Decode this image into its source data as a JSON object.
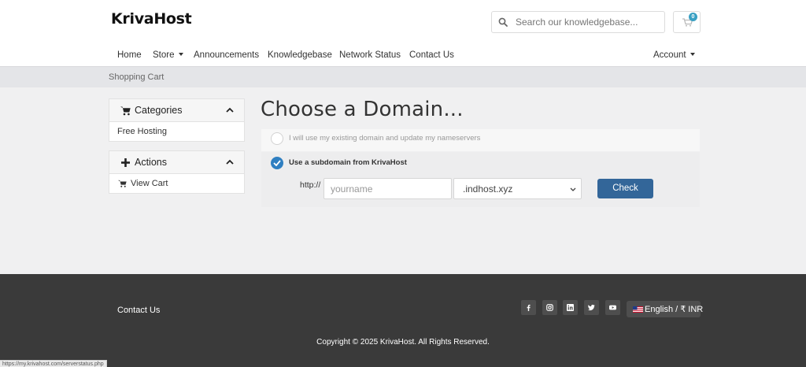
{
  "header": {
    "logo": "KrivaHost",
    "search_placeholder": "Search our knowledgebase...",
    "cart_count": "0"
  },
  "nav": {
    "home": "Home",
    "store": "Store",
    "announcements": "Announcements",
    "knowledgebase": "Knowledgebase",
    "network_status": "Network Status",
    "contact_us": "Contact Us",
    "account": "Account"
  },
  "breadcrumb": "Shopping Cart",
  "sidebar": {
    "categories": {
      "title": "Categories",
      "items": [
        "Free Hosting"
      ]
    },
    "actions": {
      "title": "Actions",
      "items": [
        "View Cart"
      ]
    }
  },
  "main": {
    "title": "Choose a Domain...",
    "option_existing": "I will use my existing domain and update my nameservers",
    "option_subdomain": "Use a subdomain from KrivaHost",
    "http_prefix": "http://",
    "subdomain_placeholder": "yourname",
    "tld_selected": ".indhost.xyz",
    "check_button": "Check"
  },
  "footer": {
    "contact_us": "Contact Us",
    "language_currency": "English / ₹ INR",
    "copyright": "Copyright © 2025 KrivaHost. All Rights Reserved.",
    "status_url": "https://my.krivahost.com/serverstatus.php"
  },
  "colors": {
    "accent": "#336699",
    "radio_selected": "#2f7fc1",
    "footer_bg": "#3a3a3a",
    "badge": "#3aa0c3"
  }
}
